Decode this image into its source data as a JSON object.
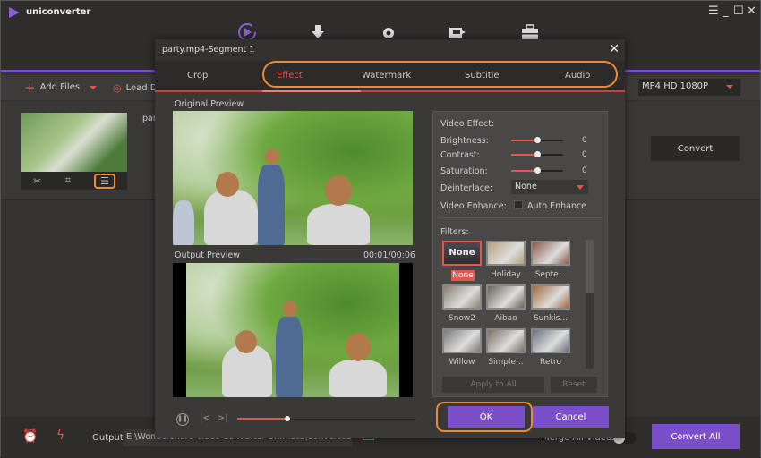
{
  "app": {
    "title": "uniconverter",
    "window_controls": {
      "menu": "☰",
      "minimize": "_",
      "maximize": "☐",
      "close": "✕"
    },
    "nav_icons": [
      "convert-icon",
      "download-icon",
      "record-icon",
      "transfer-icon",
      "toolbox-icon"
    ]
  },
  "toolbar": {
    "add_files": "Add Files",
    "load_dvd": "Load DVD",
    "output_format": "MP4 HD 1080P"
  },
  "file_row": {
    "filename_partial": "part",
    "convert_label": "Convert",
    "thumb_tools": [
      "trim-icon",
      "crop-icon",
      "effect-icon"
    ]
  },
  "bottom": {
    "output_label": "Output",
    "output_path": "E:\\Wondershare Video Converter Ultimate\\Converted",
    "merge_label": "Merge All Videos",
    "merge_on": false,
    "convert_all": "Convert All"
  },
  "dialog": {
    "title": "party.mp4-Segment 1",
    "tabs": [
      {
        "label": "Crop",
        "active": false
      },
      {
        "label": "Effect",
        "active": true
      },
      {
        "label": "Watermark",
        "active": false
      },
      {
        "label": "Subtitle",
        "active": false
      },
      {
        "label": "Audio",
        "active": false
      }
    ],
    "original_preview_label": "Original Preview",
    "output_preview_label": "Output Preview",
    "timecode": "00:01/00:06",
    "playback_progress": 0.28,
    "video_effect": {
      "heading": "Video Effect:",
      "brightness": {
        "label": "Brightness:",
        "value": "0",
        "position": 0.5
      },
      "contrast": {
        "label": "Contrast:",
        "value": "0",
        "position": 0.5
      },
      "saturation": {
        "label": "Saturation:",
        "value": "0",
        "position": 0.5
      },
      "deinterlace": {
        "label": "Deinterlace:",
        "value": "None"
      },
      "enhance": {
        "label": "Video Enhance:",
        "checkbox_label": "Auto Enhance",
        "checked": false
      }
    },
    "filters": {
      "heading": "Filters:",
      "items": [
        {
          "name": "None",
          "selected": true,
          "tone": "#3c3c44"
        },
        {
          "name": "Holiday",
          "selected": false,
          "tone": "#b9a07a"
        },
        {
          "name": "Septe...",
          "selected": false,
          "tone": "#8a5a4a"
        },
        {
          "name": "Snow2",
          "selected": false,
          "tone": "#8a8070"
        },
        {
          "name": "Aibao",
          "selected": false,
          "tone": "#6a6458"
        },
        {
          "name": "Sunkis...",
          "selected": false,
          "tone": "#a06a40"
        },
        {
          "name": "Willow",
          "selected": false,
          "tone": "#7a7a7a"
        },
        {
          "name": "Simple...",
          "selected": false,
          "tone": "#787060"
        },
        {
          "name": "Retro",
          "selected": false,
          "tone": "#6a7080"
        }
      ],
      "none_thumb_text": "None"
    },
    "apply_all": "Apply to All",
    "reset": "Reset",
    "ok": "OK",
    "cancel": "Cancel"
  },
  "colors": {
    "accent_purple": "#7b4fc9",
    "accent_red": "#e2584d",
    "highlight_orange": "#f08a2e"
  }
}
